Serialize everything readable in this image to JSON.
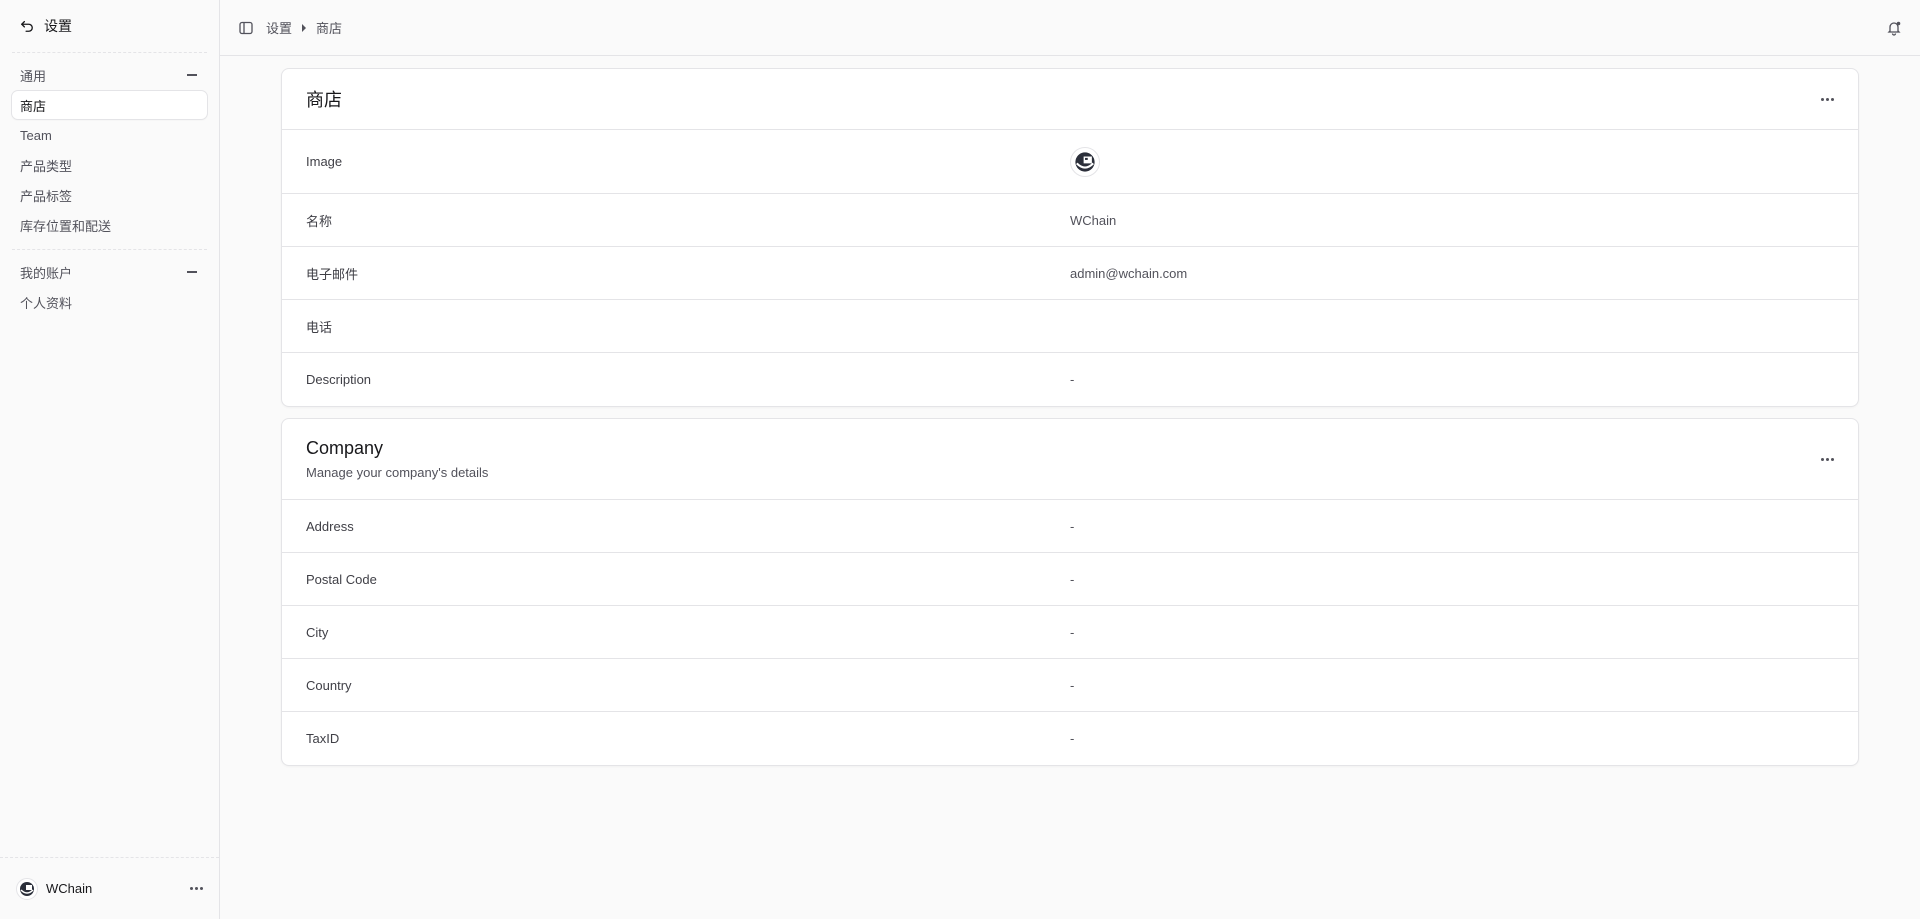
{
  "sidebar": {
    "back_label": "设置",
    "sections": [
      {
        "title": "通用",
        "items": [
          "商店",
          "Team",
          "产品类型",
          "产品标签",
          "库存位置和配送"
        ]
      },
      {
        "title": "我的账户",
        "items": [
          "个人资料"
        ]
      }
    ],
    "footer_store": "WChain"
  },
  "topbar": {
    "breadcrumb": [
      "设置",
      "商店"
    ]
  },
  "store_card": {
    "title": "商店",
    "rows": [
      {
        "label": "Image",
        "value": ""
      },
      {
        "label": "名称",
        "value": "WChain"
      },
      {
        "label": "电子邮件",
        "value": "admin@wchain.com"
      },
      {
        "label": "电话",
        "value": ""
      },
      {
        "label": "Description",
        "value": "-"
      }
    ]
  },
  "company_card": {
    "title": "Company",
    "subtitle": "Manage your company's details",
    "rows": [
      {
        "label": "Address",
        "value": "-"
      },
      {
        "label": "Postal Code",
        "value": "-"
      },
      {
        "label": "City",
        "value": "-"
      },
      {
        "label": "Country",
        "value": "-"
      },
      {
        "label": "TaxID",
        "value": "-"
      }
    ]
  }
}
